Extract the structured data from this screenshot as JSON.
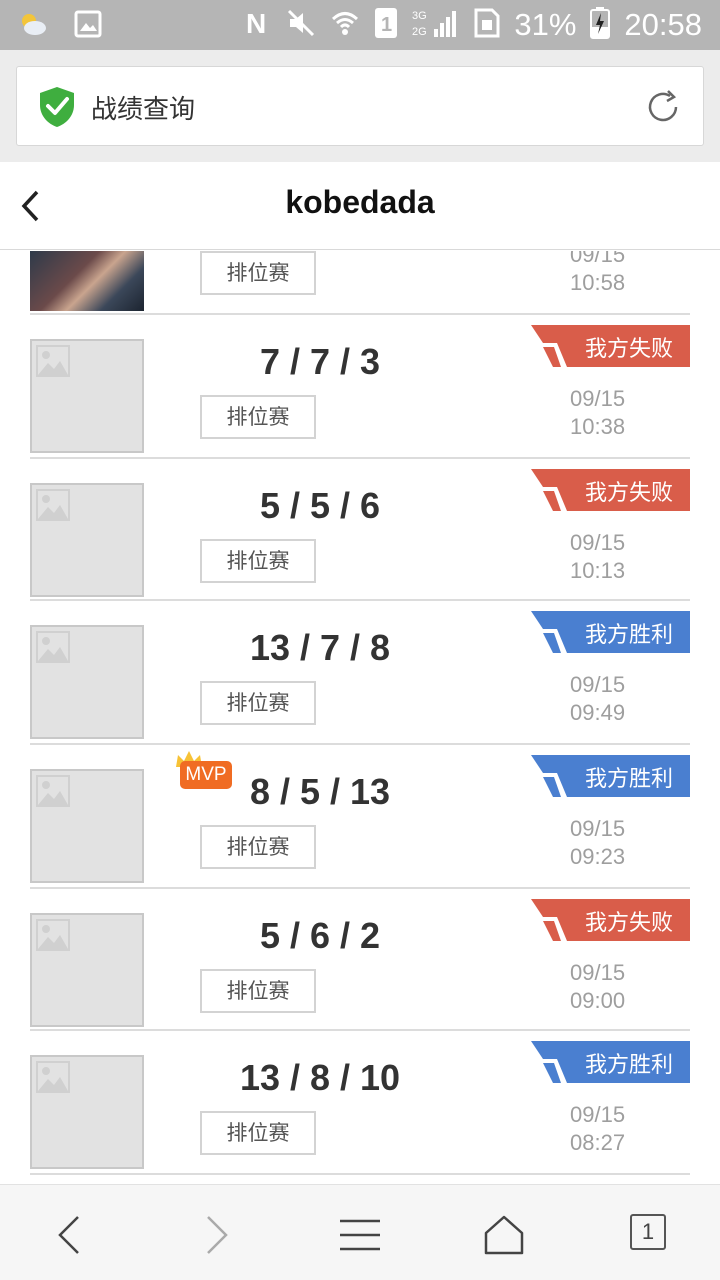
{
  "status_bar": {
    "battery": "31%",
    "time": "20:58"
  },
  "browser": {
    "page_label": "战绩查询"
  },
  "header": {
    "title": "kobedada"
  },
  "colors": {
    "loss": "#d95d4a",
    "win": "#4a7fd0",
    "mvp": "#f06c23"
  },
  "matches": [
    {
      "kda": "",
      "mode": "排位赛",
      "result": "",
      "outcome": "",
      "date": "09/15",
      "time": "10:58",
      "mvp": false
    },
    {
      "kda": "7 / 7 / 3",
      "mode": "排位赛",
      "result": "我方失败",
      "outcome": "loss",
      "date": "09/15",
      "time": "10:38",
      "mvp": false
    },
    {
      "kda": "5 / 5 / 6",
      "mode": "排位赛",
      "result": "我方失败",
      "outcome": "loss",
      "date": "09/15",
      "time": "10:13",
      "mvp": false
    },
    {
      "kda": "13 / 7 / 8",
      "mode": "排位赛",
      "result": "我方胜利",
      "outcome": "win",
      "date": "09/15",
      "time": "09:49",
      "mvp": false
    },
    {
      "kda": "8 / 5 / 13",
      "mode": "排位赛",
      "result": "我方胜利",
      "outcome": "win",
      "date": "09/15",
      "time": "09:23",
      "mvp": true,
      "mvp_label": "MVP"
    },
    {
      "kda": "5 / 6 / 2",
      "mode": "排位赛",
      "result": "我方失败",
      "outcome": "loss",
      "date": "09/15",
      "time": "09:00",
      "mvp": false
    },
    {
      "kda": "13 / 8 / 10",
      "mode": "排位赛",
      "result": "我方胜利",
      "outcome": "win",
      "date": "09/15",
      "time": "08:27",
      "mvp": false
    }
  ],
  "bottom_nav": {
    "tab_count": "1"
  }
}
